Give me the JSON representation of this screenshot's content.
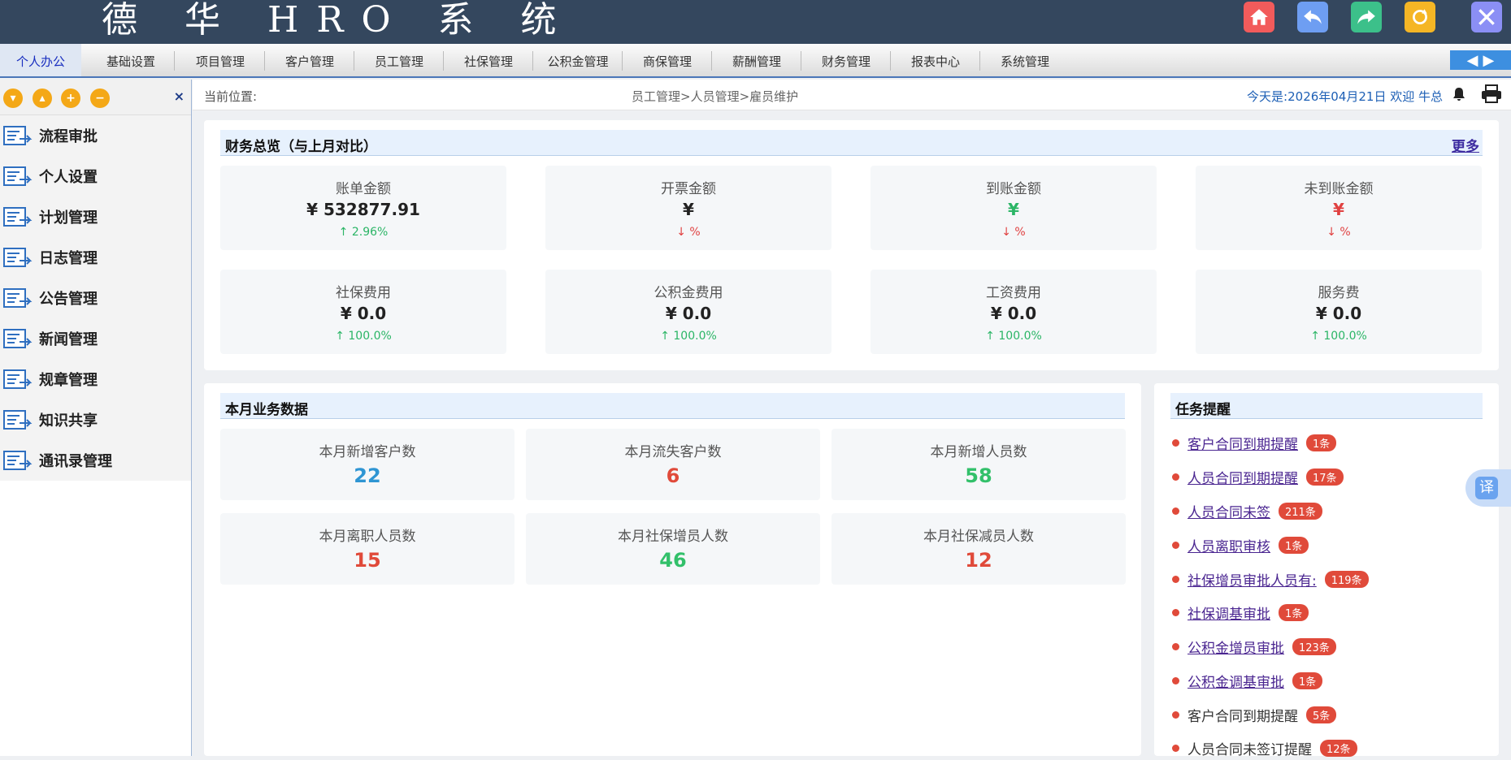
{
  "app": {
    "title": "德 华 HRO 系 统"
  },
  "top_icons": [
    {
      "name": "home-icon",
      "color": "#f25b5b"
    },
    {
      "name": "back-icon",
      "color": "#6e9ef2"
    },
    {
      "name": "forward-icon",
      "color": "#3cc08a"
    },
    {
      "name": "refresh-icon",
      "color": "#f5b625"
    },
    {
      "name": "close-icon",
      "color": "#8b8ff5"
    }
  ],
  "menu": {
    "items": [
      "个人办公",
      "基础设置",
      "项目管理",
      "客户管理",
      "员工管理",
      "社保管理",
      "公积金管理",
      "商保管理",
      "薪酬管理",
      "财务管理",
      "报表中心",
      "系统管理"
    ],
    "active": "个人办公"
  },
  "sidebar": {
    "tools": [
      "▾",
      "▴",
      "+",
      "−"
    ],
    "close": "×",
    "items": [
      "流程审批",
      "个人设置",
      "计划管理",
      "日志管理",
      "公告管理",
      "新闻管理",
      "规章管理",
      "知识共享",
      "通讯录管理"
    ]
  },
  "breadcrumb": {
    "label": "当前位置:",
    "path": "员工管理>人员管理>雇员维护",
    "welcome": "今天是:2026年04月21日 欢迎 牛总"
  },
  "finance": {
    "title": "财务总览（与上月对比）",
    "more": "更多",
    "cards": [
      {
        "label": "账单金额",
        "value": "¥ 532877.91",
        "change": "↑ 2.96%",
        "dir": "up",
        "value_color": "default"
      },
      {
        "label": "开票金额",
        "value": "¥",
        "change": "↓ %",
        "dir": "down",
        "value_color": "default"
      },
      {
        "label": "到账金额",
        "value": "¥",
        "change": "↓ %",
        "dir": "down",
        "value_color": "green"
      },
      {
        "label": "未到账金额",
        "value": "¥",
        "change": "↓ %",
        "dir": "down",
        "value_color": "red"
      },
      {
        "label": "社保费用",
        "value": "¥ 0.0",
        "change": "↑ 100.0%",
        "dir": "up",
        "value_color": "default"
      },
      {
        "label": "公积金费用",
        "value": "¥ 0.0",
        "change": "↑ 100.0%",
        "dir": "up",
        "value_color": "default"
      },
      {
        "label": "工资费用",
        "value": "¥ 0.0",
        "change": "↑ 100.0%",
        "dir": "up",
        "value_color": "default"
      },
      {
        "label": "服务费",
        "value": "¥ 0.0",
        "change": "↑ 100.0%",
        "dir": "up",
        "value_color": "default"
      }
    ]
  },
  "business": {
    "title": "本月业务数据",
    "cards": [
      {
        "label": "本月新增客户数",
        "value": "22",
        "color": "blue"
      },
      {
        "label": "本月流失客户数",
        "value": "6",
        "color": "red"
      },
      {
        "label": "本月新增人员数",
        "value": "58",
        "color": "green"
      },
      {
        "label": "本月离职人员数",
        "value": "15",
        "color": "red"
      },
      {
        "label": "本月社保增员人数",
        "value": "46",
        "color": "green"
      },
      {
        "label": "本月社保减员人数",
        "value": "12",
        "color": "red"
      }
    ]
  },
  "tasks": {
    "title": "任务提醒",
    "items": [
      {
        "label": "客户合同到期提醒",
        "badge": "1条",
        "link": true
      },
      {
        "label": "人员合同到期提醒",
        "badge": "17条",
        "link": true
      },
      {
        "label": "人员合同未签",
        "badge": "211条",
        "link": true
      },
      {
        "label": "人员离职审核",
        "badge": "1条",
        "link": true
      },
      {
        "label": "社保增员审批人员有:",
        "badge": "119条",
        "link": true
      },
      {
        "label": "社保调基审批",
        "badge": "1条",
        "link": true
      },
      {
        "label": "公积金增员审批",
        "badge": "123条",
        "link": true
      },
      {
        "label": "公积金调基审批",
        "badge": "1条",
        "link": true
      },
      {
        "label": "客户合同到期提醒",
        "badge": "5条",
        "link": false
      },
      {
        "label": "人员合同未签订提醒",
        "badge": "12条",
        "link": false
      }
    ]
  },
  "translate": {
    "label": "译"
  }
}
